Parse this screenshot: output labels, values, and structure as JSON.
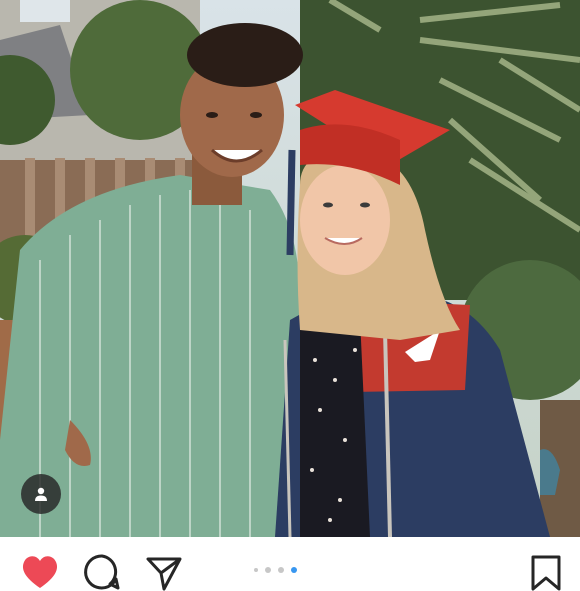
{
  "post": {
    "photo": {
      "description_icon": "photo"
    },
    "tag_button": {
      "icon": "user-icon"
    },
    "carousel": {
      "total": 4,
      "active_index": 3
    },
    "actions": {
      "like": {
        "icon": "heart-icon",
        "liked": true,
        "color": "#ed4956"
      },
      "comment": {
        "icon": "comment-icon"
      },
      "share": {
        "icon": "paper-plane-icon"
      },
      "save": {
        "icon": "bookmark-icon"
      }
    },
    "accent_color": "#3897f0"
  }
}
